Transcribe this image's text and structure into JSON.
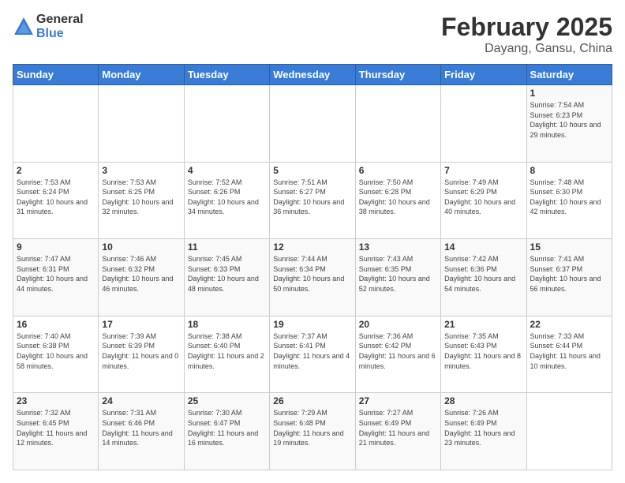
{
  "logo": {
    "general": "General",
    "blue": "Blue"
  },
  "header": {
    "title": "February 2025",
    "subtitle": "Dayang, Gansu, China"
  },
  "weekdays": [
    "Sunday",
    "Monday",
    "Tuesday",
    "Wednesday",
    "Thursday",
    "Friday",
    "Saturday"
  ],
  "weeks": [
    [
      {
        "day": "",
        "info": ""
      },
      {
        "day": "",
        "info": ""
      },
      {
        "day": "",
        "info": ""
      },
      {
        "day": "",
        "info": ""
      },
      {
        "day": "",
        "info": ""
      },
      {
        "day": "",
        "info": ""
      },
      {
        "day": "1",
        "info": "Sunrise: 7:54 AM\nSunset: 6:23 PM\nDaylight: 10 hours and 29 minutes."
      }
    ],
    [
      {
        "day": "2",
        "info": "Sunrise: 7:53 AM\nSunset: 6:24 PM\nDaylight: 10 hours and 31 minutes."
      },
      {
        "day": "3",
        "info": "Sunrise: 7:53 AM\nSunset: 6:25 PM\nDaylight: 10 hours and 32 minutes."
      },
      {
        "day": "4",
        "info": "Sunrise: 7:52 AM\nSunset: 6:26 PM\nDaylight: 10 hours and 34 minutes."
      },
      {
        "day": "5",
        "info": "Sunrise: 7:51 AM\nSunset: 6:27 PM\nDaylight: 10 hours and 36 minutes."
      },
      {
        "day": "6",
        "info": "Sunrise: 7:50 AM\nSunset: 6:28 PM\nDaylight: 10 hours and 38 minutes."
      },
      {
        "day": "7",
        "info": "Sunrise: 7:49 AM\nSunset: 6:29 PM\nDaylight: 10 hours and 40 minutes."
      },
      {
        "day": "8",
        "info": "Sunrise: 7:48 AM\nSunset: 6:30 PM\nDaylight: 10 hours and 42 minutes."
      }
    ],
    [
      {
        "day": "9",
        "info": "Sunrise: 7:47 AM\nSunset: 6:31 PM\nDaylight: 10 hours and 44 minutes."
      },
      {
        "day": "10",
        "info": "Sunrise: 7:46 AM\nSunset: 6:32 PM\nDaylight: 10 hours and 46 minutes."
      },
      {
        "day": "11",
        "info": "Sunrise: 7:45 AM\nSunset: 6:33 PM\nDaylight: 10 hours and 48 minutes."
      },
      {
        "day": "12",
        "info": "Sunrise: 7:44 AM\nSunset: 6:34 PM\nDaylight: 10 hours and 50 minutes."
      },
      {
        "day": "13",
        "info": "Sunrise: 7:43 AM\nSunset: 6:35 PM\nDaylight: 10 hours and 52 minutes."
      },
      {
        "day": "14",
        "info": "Sunrise: 7:42 AM\nSunset: 6:36 PM\nDaylight: 10 hours and 54 minutes."
      },
      {
        "day": "15",
        "info": "Sunrise: 7:41 AM\nSunset: 6:37 PM\nDaylight: 10 hours and 56 minutes."
      }
    ],
    [
      {
        "day": "16",
        "info": "Sunrise: 7:40 AM\nSunset: 6:38 PM\nDaylight: 10 hours and 58 minutes."
      },
      {
        "day": "17",
        "info": "Sunrise: 7:39 AM\nSunset: 6:39 PM\nDaylight: 11 hours and 0 minutes."
      },
      {
        "day": "18",
        "info": "Sunrise: 7:38 AM\nSunset: 6:40 PM\nDaylight: 11 hours and 2 minutes."
      },
      {
        "day": "19",
        "info": "Sunrise: 7:37 AM\nSunset: 6:41 PM\nDaylight: 11 hours and 4 minutes."
      },
      {
        "day": "20",
        "info": "Sunrise: 7:36 AM\nSunset: 6:42 PM\nDaylight: 11 hours and 6 minutes."
      },
      {
        "day": "21",
        "info": "Sunrise: 7:35 AM\nSunset: 6:43 PM\nDaylight: 11 hours and 8 minutes."
      },
      {
        "day": "22",
        "info": "Sunrise: 7:33 AM\nSunset: 6:44 PM\nDaylight: 11 hours and 10 minutes."
      }
    ],
    [
      {
        "day": "23",
        "info": "Sunrise: 7:32 AM\nSunset: 6:45 PM\nDaylight: 11 hours and 12 minutes."
      },
      {
        "day": "24",
        "info": "Sunrise: 7:31 AM\nSunset: 6:46 PM\nDaylight: 11 hours and 14 minutes."
      },
      {
        "day": "25",
        "info": "Sunrise: 7:30 AM\nSunset: 6:47 PM\nDaylight: 11 hours and 16 minutes."
      },
      {
        "day": "26",
        "info": "Sunrise: 7:29 AM\nSunset: 6:48 PM\nDaylight: 11 hours and 19 minutes."
      },
      {
        "day": "27",
        "info": "Sunrise: 7:27 AM\nSunset: 6:49 PM\nDaylight: 11 hours and 21 minutes."
      },
      {
        "day": "28",
        "info": "Sunrise: 7:26 AM\nSunset: 6:49 PM\nDaylight: 11 hours and 23 minutes."
      },
      {
        "day": "",
        "info": ""
      }
    ]
  ]
}
